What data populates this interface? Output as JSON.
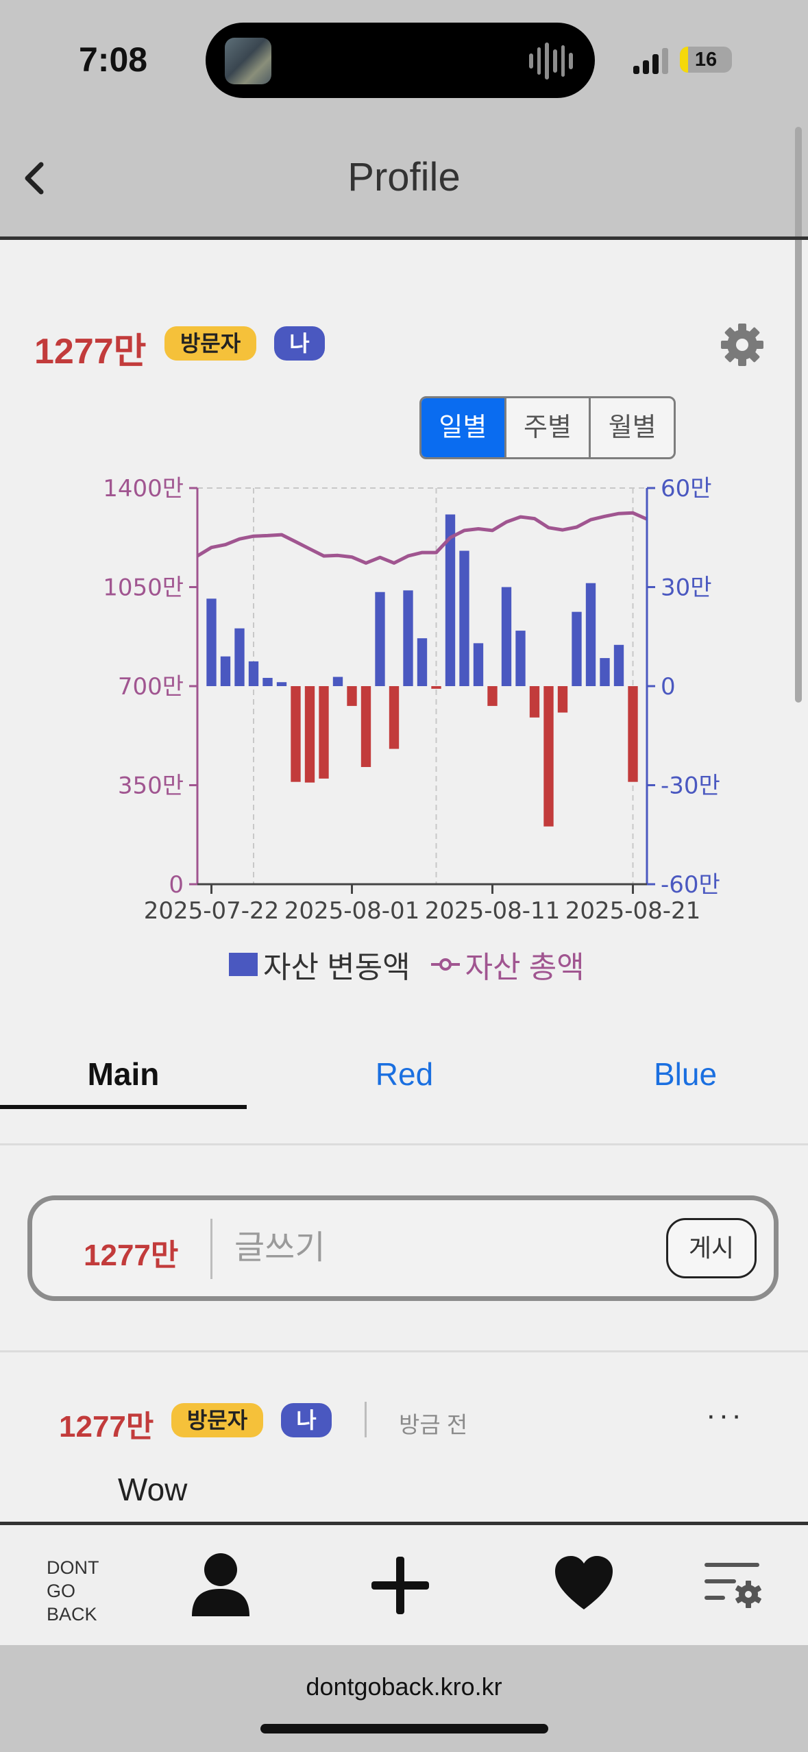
{
  "status_bar": {
    "time": "7:08",
    "battery": "16"
  },
  "header": {
    "title": "Profile"
  },
  "profile": {
    "amount": "1277만",
    "visitor_badge": "방문자",
    "me_badge": "나"
  },
  "period_toggle": {
    "options": [
      "일별",
      "주별",
      "월별"
    ],
    "selected": "일별"
  },
  "chart_data": {
    "type": "bar+line",
    "x_ticks": [
      "2025-07-22",
      "2025-08-01",
      "2025-08-11",
      "2025-08-21"
    ],
    "x_range": [
      "2025-07-21",
      "2025-08-22"
    ],
    "y_left": {
      "ticks": [
        "0",
        "350만",
        "700만",
        "1050만",
        "1400만"
      ],
      "ylim": [
        0,
        14000000
      ],
      "color": "#a05590"
    },
    "y_right": {
      "ticks": [
        "-60만",
        "-30만",
        "0",
        "30만",
        "60만"
      ],
      "ylim": [
        -600000,
        600000
      ],
      "color": "#4a58c0"
    },
    "grid": "vertical dashed",
    "legend": [
      "자산 변동액",
      "자산 총액"
    ],
    "series": [
      {
        "name": "자산 변동액",
        "kind": "bar",
        "positive_color": "#4a58c0",
        "negative_color": "#c23b3b",
        "dates": [
          "2025-07-22",
          "2025-07-23",
          "2025-07-24",
          "2025-07-25",
          "2025-07-26",
          "2025-07-27",
          "2025-07-28",
          "2025-07-29",
          "2025-07-30",
          "2025-07-31",
          "2025-08-01",
          "2025-08-02",
          "2025-08-03",
          "2025-08-04",
          "2025-08-05",
          "2025-08-06",
          "2025-08-07",
          "2025-08-08",
          "2025-08-09",
          "2025-08-10",
          "2025-08-11",
          "2025-08-12",
          "2025-08-13",
          "2025-08-14",
          "2025-08-15",
          "2025-08-16",
          "2025-08-17",
          "2025-08-18",
          "2025-08-19",
          "2025-08-20",
          "2025-08-21"
        ],
        "values": [
          265000,
          90000,
          175000,
          75000,
          25000,
          12000,
          -290000,
          -292000,
          -280000,
          28000,
          -60000,
          -245000,
          285000,
          -190000,
          290000,
          145000,
          -8000,
          520000,
          410000,
          130000,
          -60000,
          300000,
          168000,
          -95000,
          -425000,
          -80000,
          225000,
          312000,
          85000,
          125000,
          -290000
        ]
      },
      {
        "name": "자산 총액",
        "kind": "line",
        "dates": [
          "2025-07-21",
          "2025-07-22",
          "2025-07-23",
          "2025-07-24",
          "2025-07-25",
          "2025-07-26",
          "2025-07-27",
          "2025-07-28",
          "2025-07-29",
          "2025-07-30",
          "2025-07-31",
          "2025-08-01",
          "2025-08-02",
          "2025-08-03",
          "2025-08-04",
          "2025-08-05",
          "2025-08-06",
          "2025-08-07",
          "2025-08-08",
          "2025-08-09",
          "2025-08-10",
          "2025-08-11",
          "2025-08-12",
          "2025-08-13",
          "2025-08-14",
          "2025-08-15",
          "2025-08-16",
          "2025-08-17",
          "2025-08-18",
          "2025-08-19",
          "2025-08-20",
          "2025-08-21",
          "2025-08-22"
        ],
        "values": [
          11600000,
          11900000,
          12000000,
          12200000,
          12300000,
          12320000,
          12350000,
          12100000,
          11850000,
          11600000,
          11620000,
          11560000,
          11350000,
          11550000,
          11350000,
          11600000,
          11720000,
          11720000,
          12250000,
          12500000,
          12560000,
          12500000,
          12800000,
          12980000,
          12920000,
          12600000,
          12520000,
          12620000,
          12880000,
          13000000,
          13100000,
          13120000,
          12900000
        ]
      }
    ]
  },
  "tabs": [
    "Main",
    "Red",
    "Blue"
  ],
  "composer": {
    "amount": "1277만",
    "placeholder": "글쓰기",
    "post_label": "게시"
  },
  "post": {
    "amount": "1277만",
    "visitor_badge": "방문자",
    "me_badge": "나",
    "time": "방금 전",
    "more": "···",
    "body": "Wow"
  },
  "nav": {
    "logo": [
      "DONT",
      "GO",
      "BACK"
    ]
  },
  "browser": {
    "url": "dontgoback.kro.kr"
  },
  "colors": {
    "accent": "#0a6cf0",
    "red": "#c23b3b",
    "blue": "#4a58c0",
    "purple": "#a05590",
    "visitor": "#f5c13a"
  }
}
